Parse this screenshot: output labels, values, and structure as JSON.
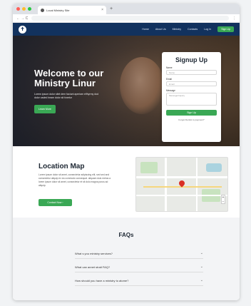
{
  "browser": {
    "tab_title": "Local Ministry Site",
    "tab_close": "×",
    "new_tab": "+",
    "nav_buttons": "←  →  C",
    "menu_glyph": "⋮"
  },
  "nav": {
    "logo_glyph": "✝",
    "items": [
      "Home",
      "About Us",
      "Ministry",
      "Contacts",
      "Log In"
    ],
    "cta": "Sign Up"
  },
  "hero": {
    "title": "Welcome to our Ministry Linur",
    "subtitle": "Lorem ipsum dolor sitet dem faciunt aperiam elfhyrmy dod dolor vaded heam dolor sit fcnetur",
    "button": "Learn More"
  },
  "signup": {
    "title": "Signup Up",
    "name_label": "Name",
    "name_placeholder": "Name",
    "email_label": "Email",
    "email_placeholder": "Email",
    "message_label": "Message",
    "message_placeholder": "Message/Inquiry",
    "submit": "Sign Up",
    "footer": "Forgot Dentist to payment?"
  },
  "location": {
    "title": "Location Map",
    "description": "Lorem ipsum dolor sit amet, consectetur adipiscing elit, sed sed and consectetur aliquip ex ea commodo consequat. aliquam duis metus a lorem ipsum dolor sit amet, consectetur et sit dolo magna purus ad aliquip.",
    "button": "Contact Now  ›"
  },
  "map": {
    "zoom_in": "+",
    "zoom_out": "−"
  },
  "faqs": {
    "title": "FAQs",
    "items": [
      {
        "question": "What s you ministry services?",
        "chevron": "⌄"
      },
      {
        "question": "What can annet strait FAQ?",
        "chevron": "⌄"
      },
      {
        "question": "How should you have a ministry to atome?",
        "chevron": "⌄"
      }
    ]
  },
  "colors": {
    "nav_bg": "#12325e",
    "accent_green": "#3aa855",
    "map_pin": "#d93025"
  }
}
